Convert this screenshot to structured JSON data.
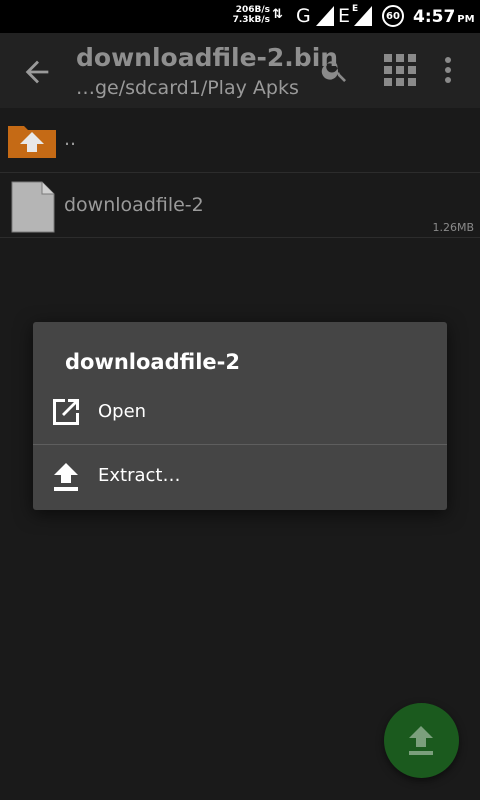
{
  "status_bar": {
    "upload_speed": "206B/s",
    "download_speed": "7.3kB/s",
    "network_g": "G",
    "network_e": "E",
    "network_e_small": "E",
    "battery_level": "60",
    "time": "4:57",
    "ampm": "PM"
  },
  "toolbar": {
    "title": "downloadfile-2.bin",
    "path": "…ge/sdcard1/Play Apks",
    "back_icon": "arrow-back-icon",
    "search_icon": "search-icon",
    "grid_icon": "grid-view-icon",
    "menu_icon": "more-vert-icon"
  },
  "files": [
    {
      "name": "..",
      "icon": "folder-up-icon",
      "size": ""
    },
    {
      "name": "downloadfile-2",
      "icon": "file-icon",
      "size": "1.26MB"
    }
  ],
  "dialog": {
    "title": "downloadfile-2",
    "items": [
      {
        "label": "Open",
        "icon": "open-external-icon"
      },
      {
        "label": "Extract…",
        "icon": "extract-icon"
      }
    ]
  },
  "fab": {
    "icon": "upload-icon"
  },
  "colors": {
    "background": "#1a1a1a",
    "toolbar": "#222222",
    "dialog": "#454545",
    "folder": "#c56a15",
    "fab": "#1b5a1e"
  }
}
